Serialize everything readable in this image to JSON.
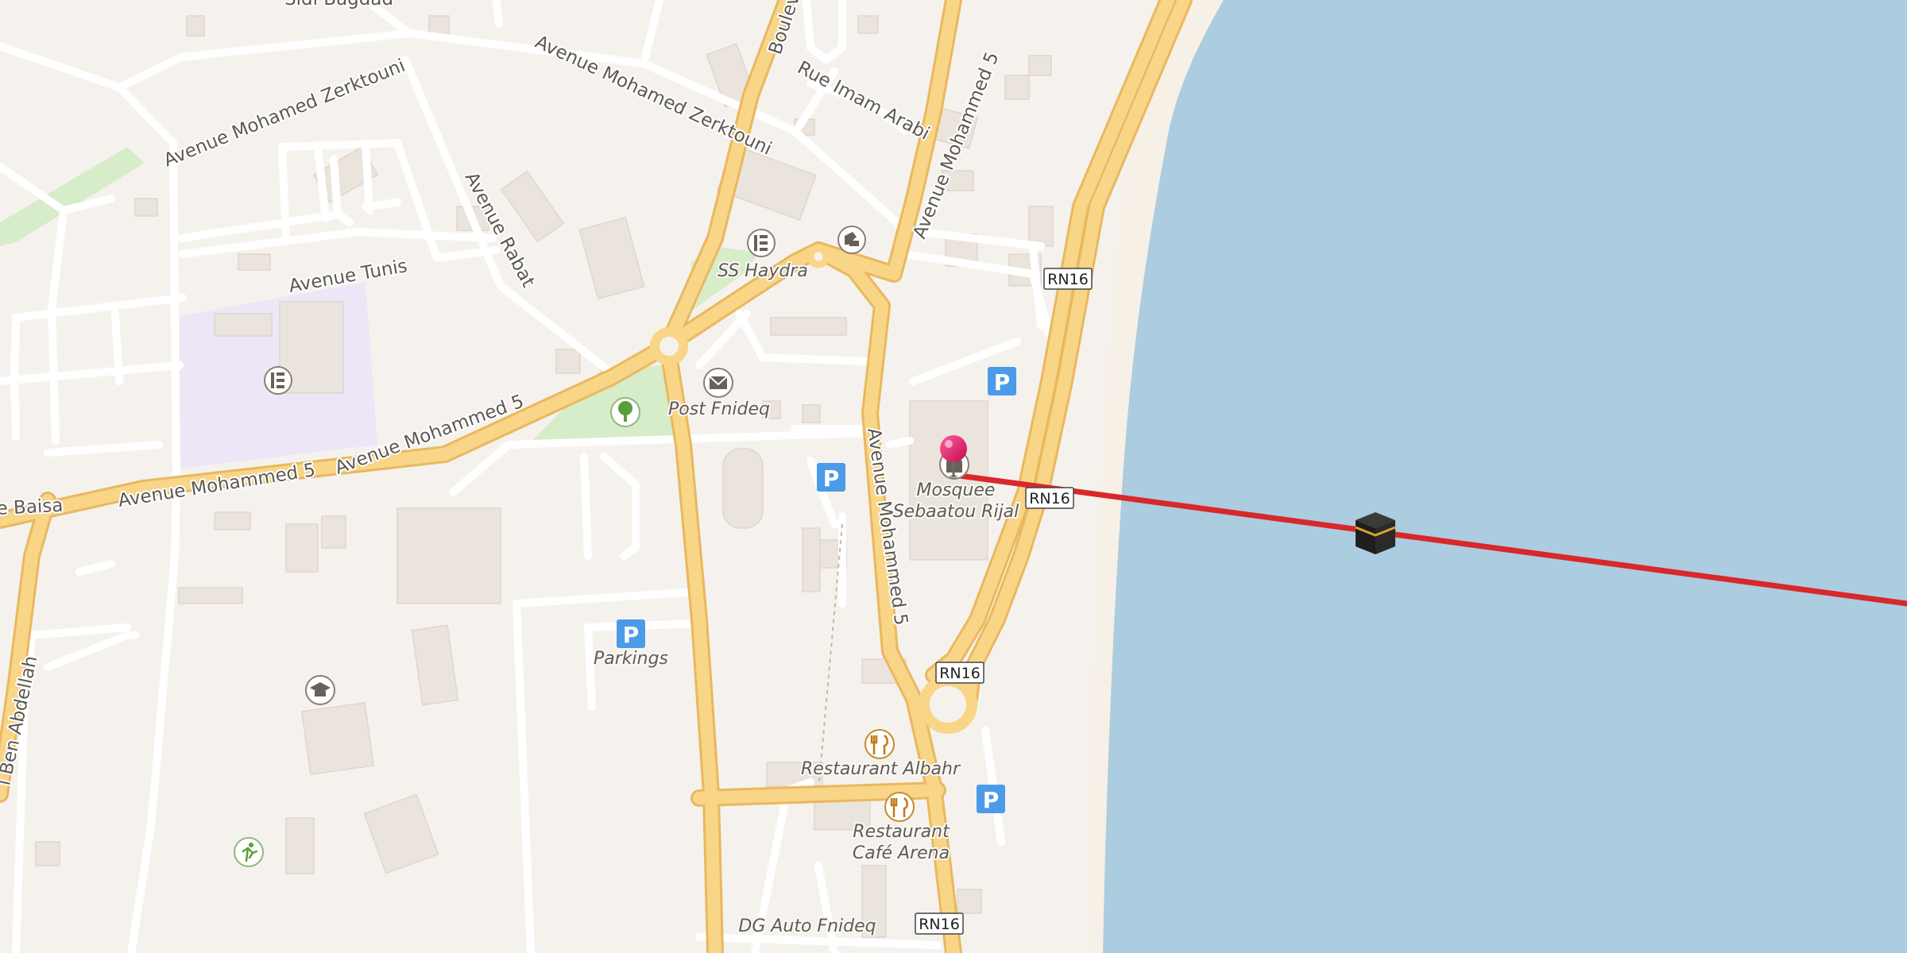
{
  "map": {
    "street_labels": {
      "avenue_mohamed_zerktouni_west": "Avenue Mohamed Zerktouni",
      "avenue_mohamed_zerktouni_east": "Avenue Mohamed Zerktouni",
      "rue_imam_arabi": "Rue Imam Arabi",
      "avenue_rabat": "Avenue Rabat",
      "avenue_tunis": "Avenue Tunis",
      "avenue_mohammed5_west": "Avenue Mohammed 5",
      "avenue_mohammed5_center": "Avenue Mohammed 5",
      "avenue_mohammed5_north": "Avenue Mohammed 5",
      "avenue_mohammed5_south": "Avenue Mohammed 5",
      "boulevard_partial": "Boulev",
      "baisa_partial": "e Baisa",
      "ben_abdellah_partial": "l Ben Abdellah",
      "top_partial": "Sidi Bagdad"
    },
    "road_shields": [
      "RN16",
      "RN16",
      "RN16",
      "RN16"
    ],
    "poi_labels": {
      "ss_haydra": "SS Haydra",
      "post_fnideq": "Post Fnideq",
      "mosquee_line1": "Mosquee",
      "mosquee_line2": "Sebaatou Rijal",
      "parkings": "Parkings",
      "restaurant_albahr": "Restaurant Albahr",
      "restaurant_cafe_line1": "Restaurant",
      "restaurant_cafe_line2": "Café Arena",
      "dg_auto": "DG Auto Fnideq"
    },
    "icons": [
      "school-icon",
      "school-icon",
      "car-repair-icon",
      "post-office-icon",
      "park-tree-icon",
      "parking-icon",
      "mosque-icon",
      "location-pin-icon",
      "kaaba-icon",
      "graduation-cap-icon",
      "restaurant-icon",
      "sports-icon"
    ],
    "colors": {
      "land": "#f5f2ee",
      "water": "#acccdf",
      "beach": "#f7f0e6",
      "major_road": "#f8d587",
      "major_road_casing": "#e9b85f",
      "minor_road": "#ffffff",
      "building": "#ebe4dc",
      "park": "#d7ecc9",
      "school_area": "#ece6f7",
      "qibla_line": "#d8282b",
      "pin": "#e31665",
      "parking": "#4c9be8"
    }
  }
}
